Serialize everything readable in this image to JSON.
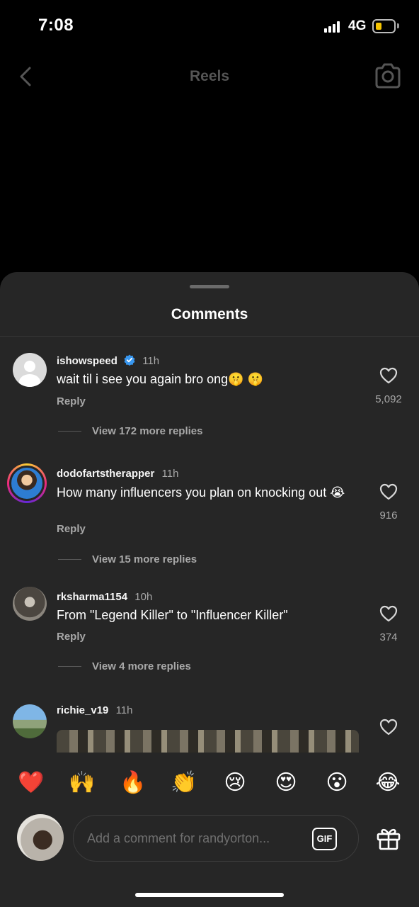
{
  "status_bar": {
    "time": "7:08",
    "network": "4G",
    "battery_color": "#f5c400"
  },
  "header": {
    "title": "Reels",
    "back_icon": "chevron-left-icon",
    "camera_icon": "camera-icon"
  },
  "sheet": {
    "title": "Comments"
  },
  "comments": [
    {
      "username": "ishowspeed",
      "verified": true,
      "time": "11h",
      "text": "wait til i see you again bro ong🤫 🤫",
      "reply_label": "Reply",
      "likes": "5,092",
      "view_replies": "View 172 more replies"
    },
    {
      "username": "dodofartstherapper",
      "verified": false,
      "time": "11h",
      "text": "How many influencers you plan on knocking out 😭",
      "reply_label": "Reply",
      "likes": "916",
      "view_replies": "View 15 more replies"
    },
    {
      "username": "rksharma1154",
      "verified": false,
      "time": "10h",
      "text": "From \"Legend Killer\" to \"Influencer Killer\"",
      "reply_label": "Reply",
      "likes": "374",
      "view_replies": "View 4 more replies"
    },
    {
      "username": "richie_v19",
      "verified": false,
      "time": "11h"
    }
  ],
  "emoji_bar": [
    "❤️",
    "🙌",
    "🔥",
    "👏",
    "😢",
    "😍",
    "😮",
    "😂"
  ],
  "composer": {
    "placeholder": "Add a comment for randyorton...",
    "gif_label": "GIF"
  },
  "colors": {
    "sheet_bg": "#262626",
    "secondary_text": "#a8a8a8",
    "verified_blue": "#3897f0"
  }
}
